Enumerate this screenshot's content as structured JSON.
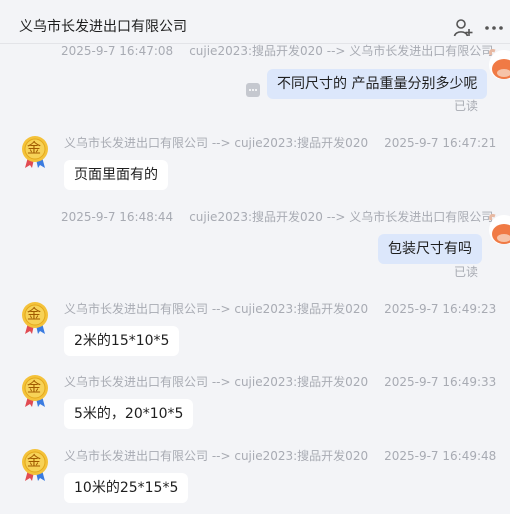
{
  "header": {
    "title": "义乌市长发进出口有限公司",
    "icons": [
      "add-person-icon",
      "more-icon"
    ]
  },
  "messages": [
    {
      "direction": "out",
      "timestamp": "2025-9-7 16:47:08",
      "route": "cujie2023:搜品开发020 --> 义乌市长发进出口有限公司",
      "text": "不同尺寸的 产品重量分别多少呢",
      "status": "已读"
    },
    {
      "direction": "in",
      "route": "义乌市长发进出口有限公司 --> cujie2023:搜品开发020",
      "timestamp": "2025-9-7 16:47:21",
      "text": "页面里面有的"
    },
    {
      "direction": "out",
      "timestamp": "2025-9-7 16:48:44",
      "route": "cujie2023:搜品开发020 --> 义乌市长发进出口有限公司",
      "text": "包装尺寸有吗",
      "status": "已读"
    },
    {
      "direction": "in",
      "route": "义乌市长发进出口有限公司 --> cujie2023:搜品开发020",
      "timestamp": "2025-9-7 16:49:23",
      "text": "2米的15*10*5"
    },
    {
      "direction": "in",
      "route": "义乌市长发进出口有限公司 --> cujie2023:搜品开发020",
      "timestamp": "2025-9-7 16:49:33",
      "text": "5米的，20*10*5"
    },
    {
      "direction": "in",
      "route": "义乌市长发进出口有限公司 --> cujie2023:搜品开发020",
      "timestamp": "2025-9-7 16:49:48",
      "text": "10米的25*15*5"
    }
  ],
  "avatars": {
    "gold_badge_char": "金"
  },
  "colors": {
    "outgoing_bubble": "#dce7fb",
    "incoming_bubble": "#ffffff",
    "meta_text": "#a8abb3",
    "background": "#f3f4f7"
  }
}
